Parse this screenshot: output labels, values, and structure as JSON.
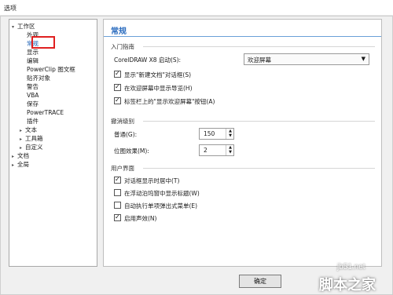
{
  "window": {
    "title": "选项"
  },
  "tree": {
    "items": [
      {
        "label": "工作区",
        "toggle": "▾",
        "indent": 0,
        "selected": false
      },
      {
        "label": "外观",
        "toggle": "",
        "indent": 1,
        "selected": false
      },
      {
        "label": "常规",
        "toggle": "",
        "indent": 1,
        "selected": true
      },
      {
        "label": "显示",
        "toggle": "",
        "indent": 1,
        "selected": false
      },
      {
        "label": "编辑",
        "toggle": "",
        "indent": 1,
        "selected": false
      },
      {
        "label": "PowerClip 图文框",
        "toggle": "",
        "indent": 1,
        "selected": false
      },
      {
        "label": "贴齐对象",
        "toggle": "",
        "indent": 1,
        "selected": false
      },
      {
        "label": "警告",
        "toggle": "",
        "indent": 1,
        "selected": false
      },
      {
        "label": "VBA",
        "toggle": "",
        "indent": 1,
        "selected": false
      },
      {
        "label": "保存",
        "toggle": "",
        "indent": 1,
        "selected": false
      },
      {
        "label": "PowerTRACE",
        "toggle": "",
        "indent": 1,
        "selected": false
      },
      {
        "label": "插件",
        "toggle": "",
        "indent": 1,
        "selected": false
      },
      {
        "label": "文本",
        "toggle": "▸",
        "indent": 1,
        "selected": false
      },
      {
        "label": "工具箱",
        "toggle": "▸",
        "indent": 1,
        "selected": false
      },
      {
        "label": "自定义",
        "toggle": "▸",
        "indent": 1,
        "selected": false
      },
      {
        "label": "文档",
        "toggle": "▸",
        "indent": 0,
        "selected": false
      },
      {
        "label": "全局",
        "toggle": "▸",
        "indent": 0,
        "selected": false
      }
    ]
  },
  "panel": {
    "title": "常规",
    "startup_group": {
      "header": "入门指南",
      "startup_label": "CorelDRAW X8 启动(S):",
      "startup_value": "欢迎屏幕",
      "checks": [
        {
          "label": "显示\"新建文档\"对话框(S)",
          "checked": true
        },
        {
          "label": "在欢迎屏幕中显示导览(H)",
          "checked": true
        },
        {
          "label": "标签栏上的\"显示欢迎屏幕\"按钮(A)",
          "checked": true
        }
      ]
    },
    "undo_group": {
      "header": "撤消级别",
      "normal_label": "普通(G):",
      "normal_value": "150",
      "bitmap_label": "位图效果(M):",
      "bitmap_value": "2"
    },
    "ui_group": {
      "header": "用户界面",
      "checks": [
        {
          "label": "对话框显示时居中(T)",
          "checked": true
        },
        {
          "label": "在浮动泊坞窗中显示标题(W)",
          "checked": false
        },
        {
          "label": "自动执行单项弹出式菜单(E)",
          "checked": false
        },
        {
          "label": "启用声效(N)",
          "checked": true
        }
      ]
    }
  },
  "footer": {
    "ok_label": "确定"
  },
  "watermark": {
    "line1": "jb51.net",
    "line2": "脚本之家"
  },
  "colors": {
    "accent": "#2b6cbf",
    "selection_outline": "#e02020"
  }
}
